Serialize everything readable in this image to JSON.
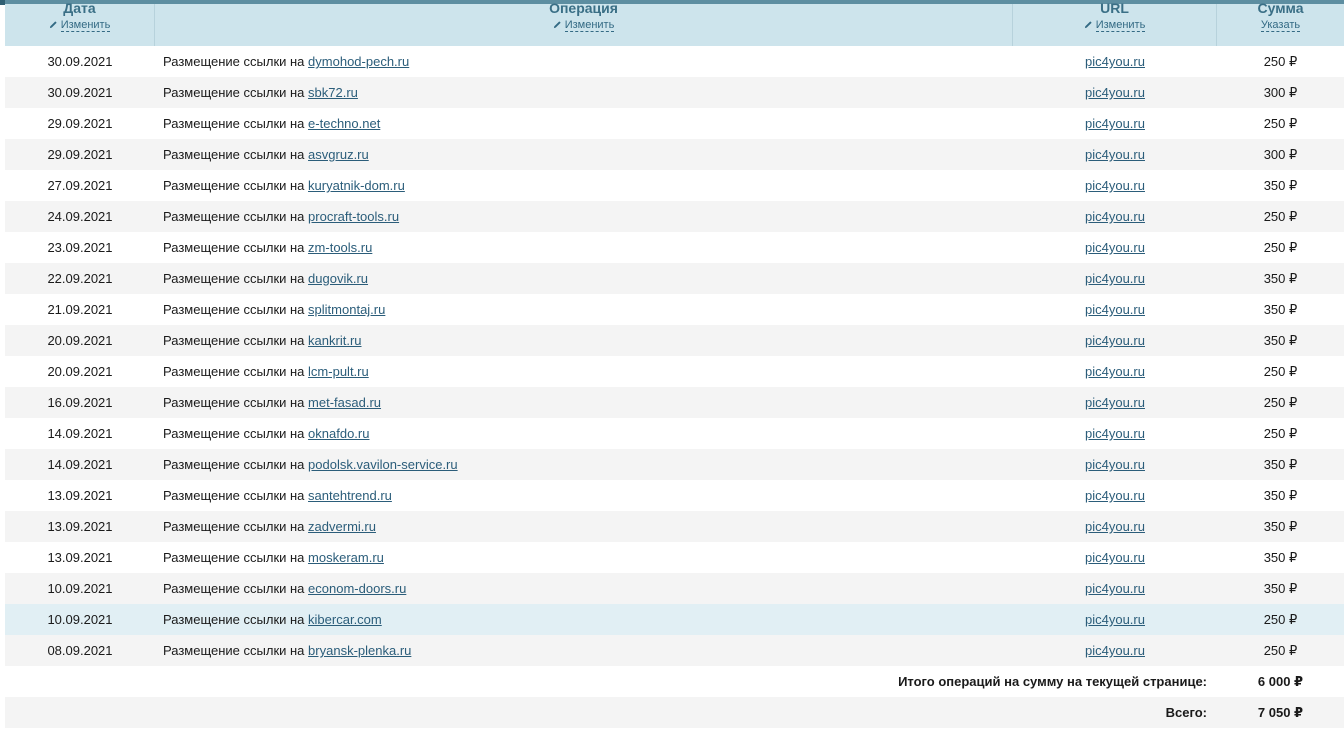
{
  "header": {
    "date": {
      "title": "Дата",
      "action": "Изменить"
    },
    "operation": {
      "title": "Операция",
      "action": "Изменить"
    },
    "url": {
      "title": "URL",
      "action": "Изменить"
    },
    "sum": {
      "title": "Сумма",
      "action": "Указать"
    }
  },
  "operation_prefix": "Размещение ссылки на",
  "rows": [
    {
      "date": "30.09.2021",
      "site": "dymohod-pech.ru",
      "url": "pic4you.ru",
      "sum": "250 ₽"
    },
    {
      "date": "30.09.2021",
      "site": "sbk72.ru",
      "url": "pic4you.ru",
      "sum": "300 ₽"
    },
    {
      "date": "29.09.2021",
      "site": "e-techno.net",
      "url": "pic4you.ru",
      "sum": "250 ₽"
    },
    {
      "date": "29.09.2021",
      "site": "asvgruz.ru",
      "url": "pic4you.ru",
      "sum": "300 ₽"
    },
    {
      "date": "27.09.2021",
      "site": "kuryatnik-dom.ru",
      "url": "pic4you.ru",
      "sum": "350 ₽"
    },
    {
      "date": "24.09.2021",
      "site": "procraft-tools.ru",
      "url": "pic4you.ru",
      "sum": "250 ₽"
    },
    {
      "date": "23.09.2021",
      "site": "zm-tools.ru",
      "url": "pic4you.ru",
      "sum": "250 ₽"
    },
    {
      "date": "22.09.2021",
      "site": "dugovik.ru",
      "url": "pic4you.ru",
      "sum": "350 ₽"
    },
    {
      "date": "21.09.2021",
      "site": "splitmontaj.ru",
      "url": "pic4you.ru",
      "sum": "350 ₽"
    },
    {
      "date": "20.09.2021",
      "site": "kankrit.ru",
      "url": "pic4you.ru",
      "sum": "350 ₽"
    },
    {
      "date": "20.09.2021",
      "site": "lcm-pult.ru",
      "url": "pic4you.ru",
      "sum": "250 ₽"
    },
    {
      "date": "16.09.2021",
      "site": "met-fasad.ru",
      "url": "pic4you.ru",
      "sum": "250 ₽"
    },
    {
      "date": "14.09.2021",
      "site": "oknafdo.ru",
      "url": "pic4you.ru",
      "sum": "250 ₽"
    },
    {
      "date": "14.09.2021",
      "site": "podolsk.vavilon-service.ru",
      "url": "pic4you.ru",
      "sum": "350 ₽"
    },
    {
      "date": "13.09.2021",
      "site": "santehtrend.ru",
      "url": "pic4you.ru",
      "sum": "350 ₽"
    },
    {
      "date": "13.09.2021",
      "site": "zadvermi.ru",
      "url": "pic4you.ru",
      "sum": "350 ₽"
    },
    {
      "date": "13.09.2021",
      "site": "moskeram.ru",
      "url": "pic4you.ru",
      "sum": "350 ₽"
    },
    {
      "date": "10.09.2021",
      "site": "econom-doors.ru",
      "url": "pic4you.ru",
      "sum": "350 ₽"
    },
    {
      "date": "10.09.2021",
      "site": "kibercar.com",
      "url": "pic4you.ru",
      "sum": "250 ₽"
    },
    {
      "date": "08.09.2021",
      "site": "bryansk-plenka.ru",
      "url": "pic4you.ru",
      "sum": "250 ₽"
    }
  ],
  "highlighted_row": 18,
  "totals": {
    "page_label": "Итого операций на сумму на текущей странице:",
    "page_value": "6 000 ₽",
    "all_label": "Всего:",
    "all_value": "7 050 ₽"
  }
}
